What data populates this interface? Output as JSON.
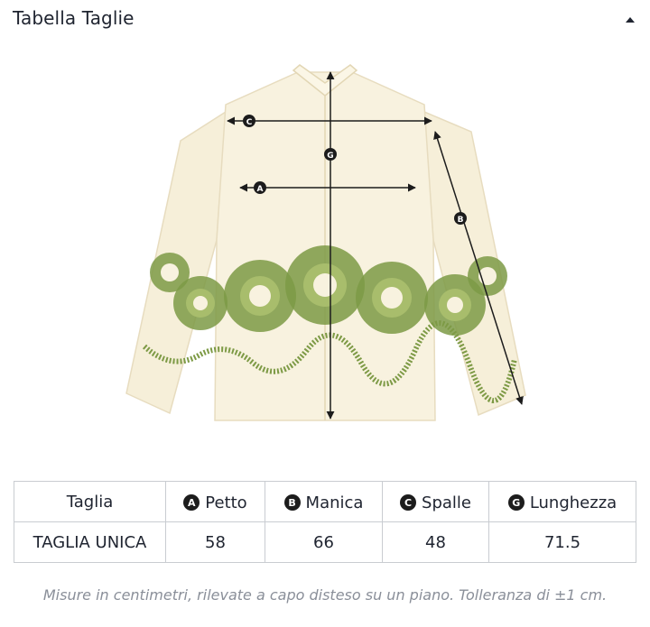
{
  "header": {
    "title": "Tabella Taglie",
    "toggle_icon": "caret-up-icon"
  },
  "figure": {
    "markers": {
      "a": "A",
      "b": "B",
      "c": "C",
      "g": "G"
    },
    "colors": {
      "fabric": "#f6efd9",
      "embroidery": "#7d9a45",
      "embroidery_light": "#a8bd6c",
      "line": "#1c1c1c"
    }
  },
  "table": {
    "headers": [
      {
        "badge": "",
        "label": "Taglia"
      },
      {
        "badge": "A",
        "label": "Petto"
      },
      {
        "badge": "B",
        "label": "Manica"
      },
      {
        "badge": "C",
        "label": "Spalle"
      },
      {
        "badge": "G",
        "label": "Lunghezza"
      }
    ],
    "rows": [
      [
        "TAGLIA UNICA",
        "58",
        "66",
        "48",
        "71.5"
      ]
    ]
  },
  "note": "Misure in centimetri, rilevate a capo disteso su un piano. Tolleranza di ±1 cm."
}
